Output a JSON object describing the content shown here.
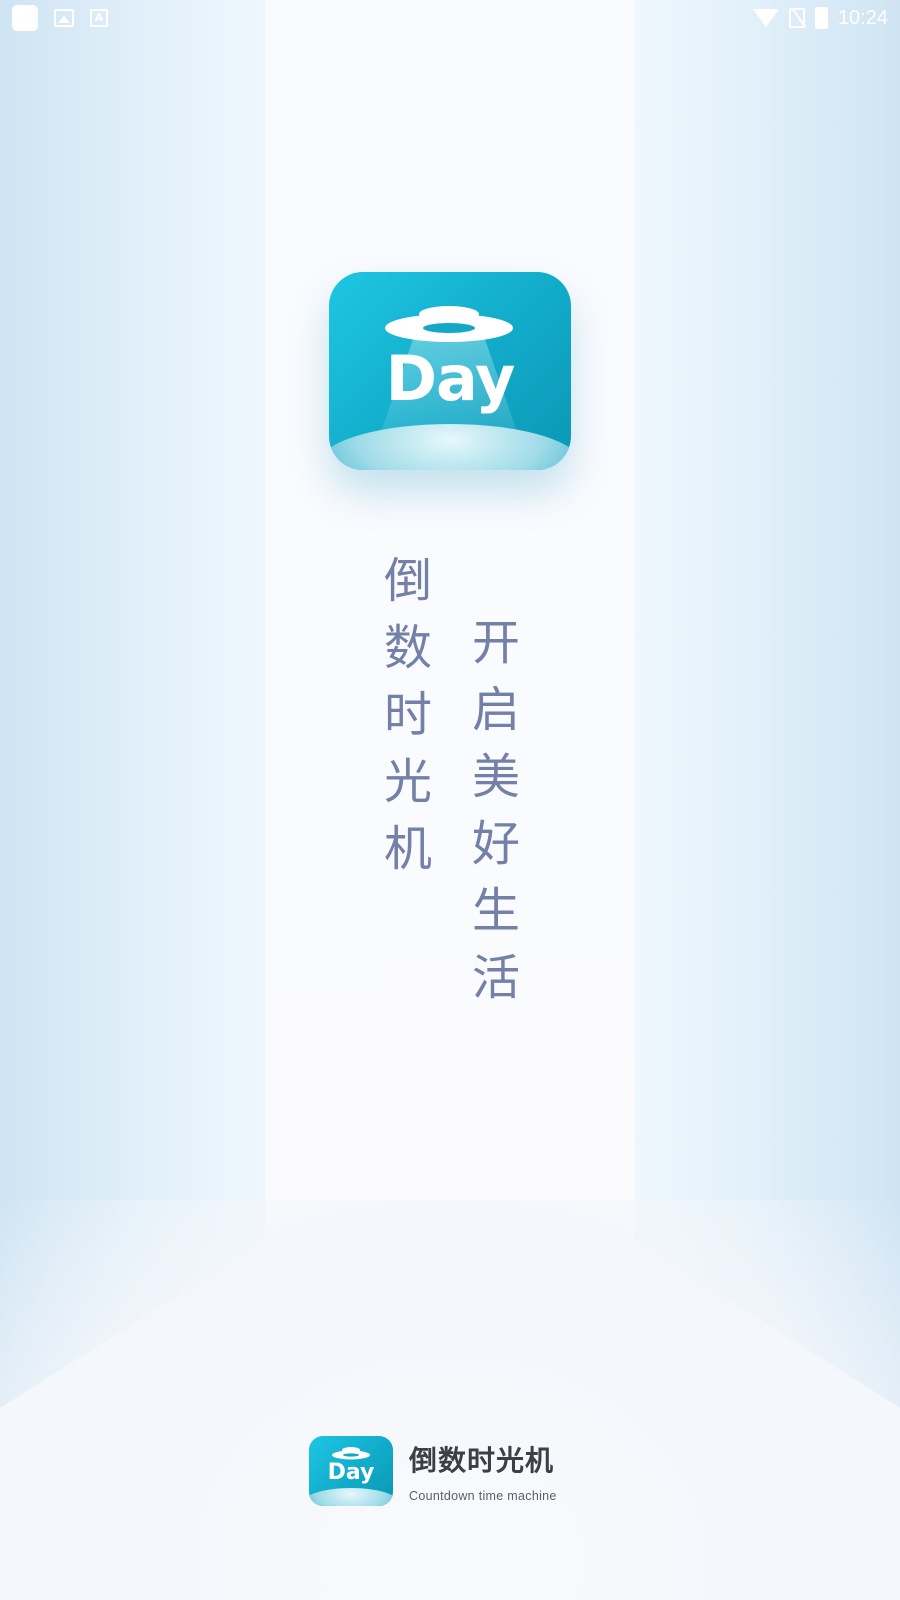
{
  "status_bar": {
    "time": "10:24",
    "left_icons": [
      "app-square-icon",
      "image-icon",
      "font-a-icon"
    ],
    "right_icons": [
      "wifi-icon",
      "no-sim-icon",
      "battery-charging-icon"
    ],
    "a_glyph": "A"
  },
  "splash": {
    "app_icon_text": "Day",
    "slogan_column_1": [
      "倒",
      "数",
      "时",
      "光",
      "机"
    ],
    "slogan_column_2": [
      "开",
      "启",
      "美",
      "好",
      "生",
      "活"
    ]
  },
  "brand": {
    "icon_text": "Day",
    "name": "倒数时光机",
    "subtitle": "Countdown time machine"
  },
  "colors": {
    "icon_teal": "#11abc9",
    "slogan_text": "#7380a8",
    "panel_blue": "#cfe4f3"
  }
}
